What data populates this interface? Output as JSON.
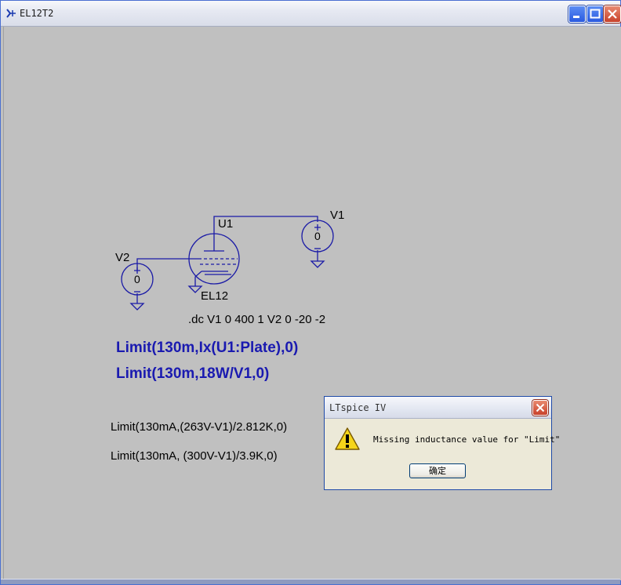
{
  "window": {
    "title": "EL12T2"
  },
  "schematic": {
    "tube": {
      "ref": "U1",
      "model": "EL12"
    },
    "source_v1": {
      "ref": "V1",
      "value": "0"
    },
    "source_v2": {
      "ref": "V2",
      "value": "0"
    },
    "directive": ".dc V1 0 400 1 V2 0 -20 -2",
    "expressions_bold": [
      "Limit(130m,Ix(U1:Plate),0)",
      "Limit(130m,18W/V1,0)"
    ],
    "expressions_plain": [
      "Limit(130mA,(263V-V1)/2.812K,0)",
      "Limit(130mA, (300V-V1)/3.9K,0)"
    ],
    "wire_color": "#1a1aa6"
  },
  "dialog": {
    "title": "LTspice IV",
    "message": "Missing inductance value for \"Limit\"",
    "ok_label": "确定"
  }
}
